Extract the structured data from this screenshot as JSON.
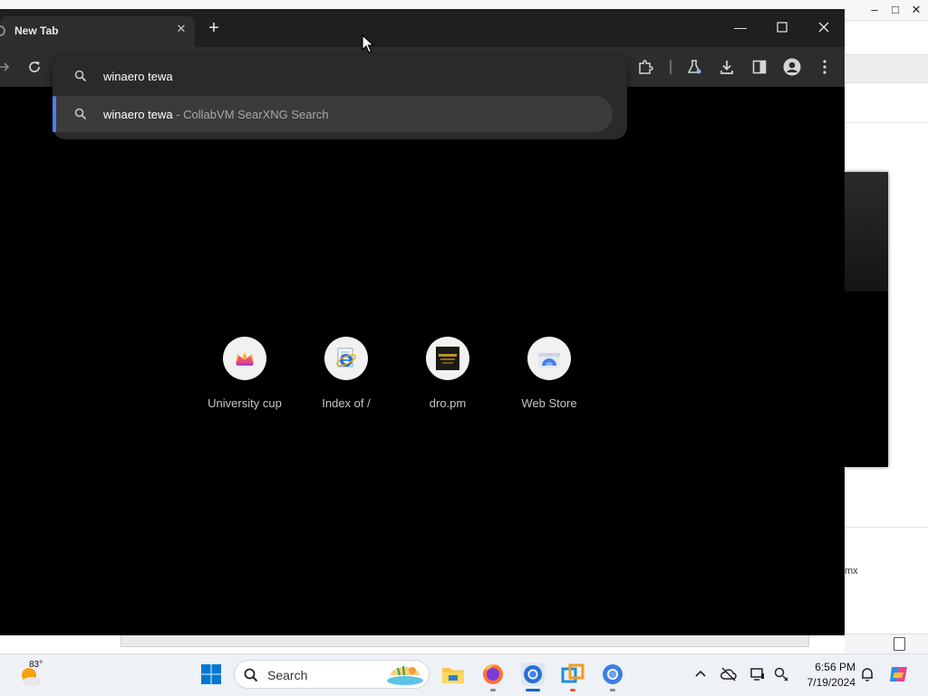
{
  "browser": {
    "tab_title": "New Tab",
    "omnibox": {
      "input_text": "winaero tewa",
      "suggestion_query": "winaero tewa",
      "suggestion_suffix": " - CollabVM SearXNG Search"
    },
    "shortcuts": [
      {
        "label": "University cup",
        "icon": "crown-icon"
      },
      {
        "label": "Index of /",
        "icon": "internet-explorer-icon"
      },
      {
        "label": "dro.pm",
        "icon": "dropm-thumbnail-icon"
      },
      {
        "label": "Web Store",
        "icon": "webstore-icon"
      }
    ],
    "toolbar_icons": [
      "forward-icon",
      "reload-icon",
      "extensions-icon",
      "labs-icon",
      "downloads-icon",
      "side-panel-icon",
      "profile-icon",
      "menu-icon"
    ],
    "colors": {
      "accent": "#4d7ff0",
      "toolbar": "#2d2d2d",
      "ntp_background": "#000000"
    }
  },
  "background_window": {
    "partial_text": "mx"
  },
  "taskbar": {
    "weather_temp": "83°",
    "search_label": "Search",
    "clock_time": "6:56 PM",
    "clock_date": "7/19/2024",
    "apps": [
      "start-icon",
      "search-icon",
      "widgets-icon",
      "file-explorer-icon",
      "firefox-icon",
      "chrome-icon",
      "vmware-icon",
      "chrome-alt-icon"
    ],
    "tray": [
      "chevron-up-icon",
      "onedrive-offline-icon",
      "display-icon",
      "network-icon",
      "notification-bell-icon",
      "copilot-icon"
    ]
  }
}
